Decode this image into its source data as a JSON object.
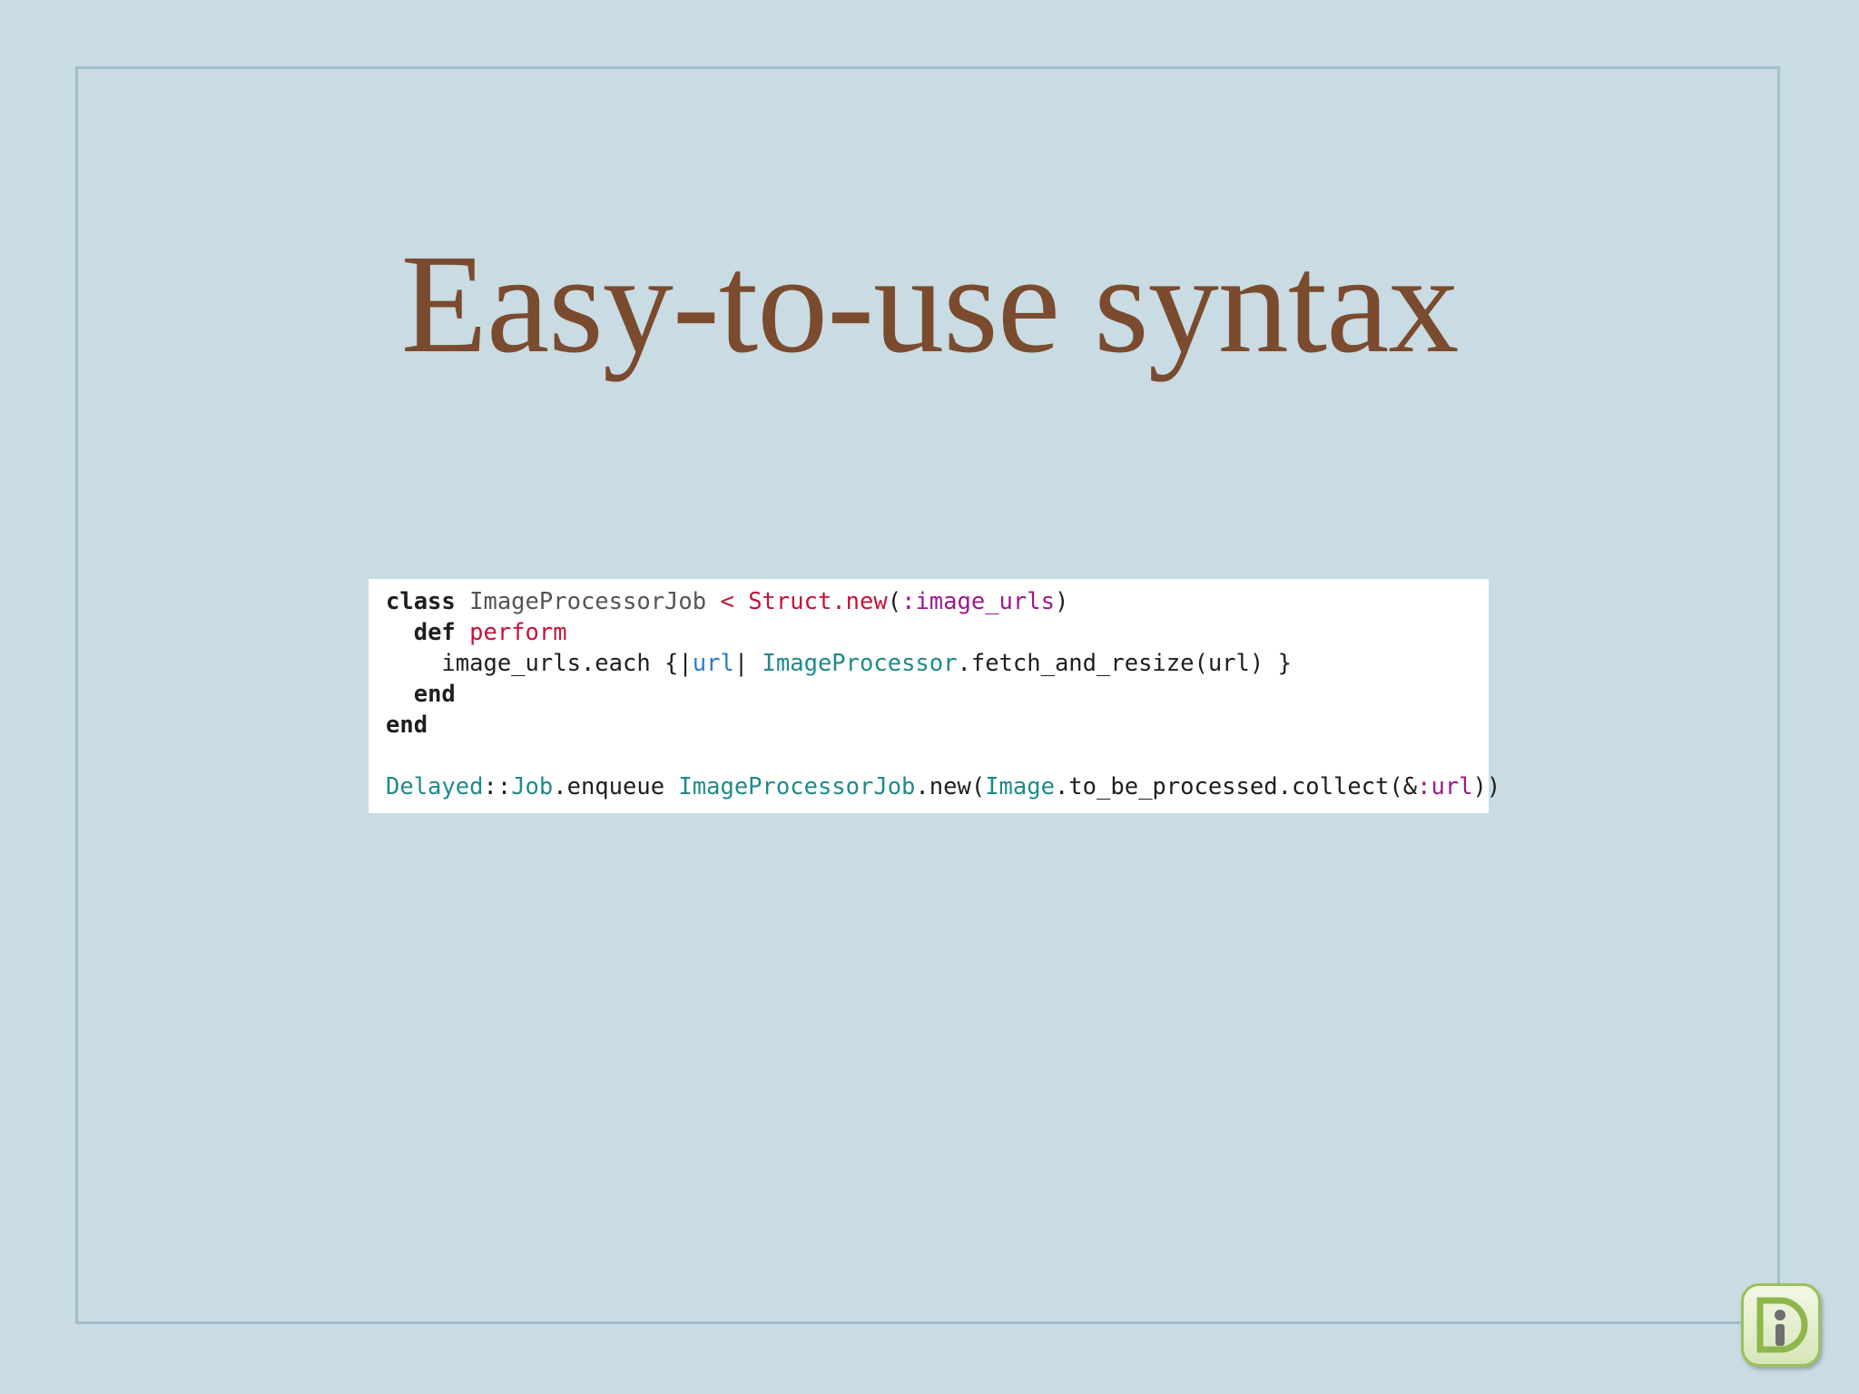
{
  "slide": {
    "title": "Easy-to-use syntax"
  },
  "code": {
    "line1": {
      "kw_class": "class",
      "class_name": "ImageProcessorJob",
      "lt": "<",
      "struct": "Struct.new",
      "open": "(",
      "sym": ":image_urls",
      "close": ")"
    },
    "line2": {
      "kw_def": "def",
      "method": "perform"
    },
    "line3": {
      "recv": "image_urls.each {|",
      "var": "url",
      "pipe": "| ",
      "const": "ImageProcessor",
      "rest": ".fetch_and_resize(url) }"
    },
    "line4": {
      "kw_end": "end"
    },
    "line5": {
      "kw_end": "end"
    },
    "line7": {
      "const1": "Delayed",
      "sep": "::",
      "const2": "Job",
      "call": ".enqueue ",
      "const3": "ImageProcessorJob",
      "new_call": ".new(",
      "const4": "Image",
      "chain": ".to_be_processed.collect(&",
      "sym": ":url",
      "close": "))"
    }
  },
  "colors": {
    "background": "#c9dbe3",
    "title": "#7a4b2e",
    "keyword_red": "#c4143a",
    "symbol_purple": "#9b1a8a",
    "constant_teal": "#1f8a8a"
  },
  "icons": {
    "logo": "info-badge-icon"
  }
}
